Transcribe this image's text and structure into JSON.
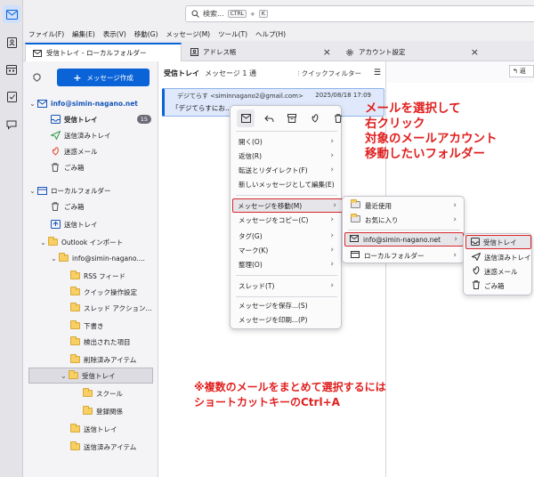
{
  "titlebar": {
    "search_placeholder": "検索...",
    "shortcut_key1": "CTRL",
    "shortcut_plus": "+",
    "shortcut_key2": "K"
  },
  "menubar": [
    "ファイル(F)",
    "編集(E)",
    "表示(V)",
    "移動(G)",
    "メッセージ(M)",
    "ツール(T)",
    "ヘルプ(H)"
  ],
  "tabs": [
    {
      "label": "受信トレイ - ローカルフォルダー",
      "icon": "mail-icon"
    },
    {
      "label": "アドレス帳",
      "icon": "address-book-icon"
    },
    {
      "label": "アカウント設定",
      "icon": "gear-icon"
    }
  ],
  "folder_pane": {
    "compose_label": "メッセージ作成",
    "accounts": [
      {
        "name": "info@simin-nagano.net",
        "folders": [
          {
            "label": "受信トレイ",
            "badge": "15",
            "icon": "inbox-icon"
          },
          {
            "label": "送信済みトレイ",
            "icon": "send-icon"
          },
          {
            "label": "迷惑メール",
            "icon": "junk-icon"
          },
          {
            "label": "ごみ箱",
            "icon": "trash-icon"
          }
        ]
      },
      {
        "name": "ローカルフォルダー",
        "folders": [
          {
            "label": "ごみ箱",
            "icon": "trash-icon"
          },
          {
            "label": "送信トレイ",
            "icon": "outbox-icon"
          },
          {
            "label": "Outlook インポート",
            "icon": "folder-icon"
          },
          {
            "label": "info@simin-nagano....",
            "icon": "folder-icon"
          },
          {
            "label": "RSS フィード",
            "icon": "folder-icon"
          },
          {
            "label": "クイック操作設定",
            "icon": "folder-icon"
          },
          {
            "label": "スレッド アクション...",
            "icon": "folder-icon"
          },
          {
            "label": "下書き",
            "icon": "folder-icon"
          },
          {
            "label": "検出された項目",
            "icon": "folder-icon"
          },
          {
            "label": "削除済みアイテム",
            "icon": "folder-icon"
          },
          {
            "label": "受信トレイ",
            "icon": "folder-icon"
          },
          {
            "label": "スクール",
            "icon": "folder-icon"
          },
          {
            "label": "登録関係",
            "icon": "folder-icon"
          },
          {
            "label": "送信トレイ",
            "icon": "folder-icon"
          },
          {
            "label": "送信済みアイテム",
            "icon": "folder-icon"
          }
        ]
      }
    ]
  },
  "message_list": {
    "title": "受信トレイ",
    "count": "メッセージ 1 通",
    "quick_filter": "クイックフィルター",
    "message": {
      "from": "デジてらす <siminnagano2@gmail.com>",
      "date": "2025/08/18 17:09",
      "subject": "「デジてらすにお..."
    }
  },
  "preview": {
    "reply_label": "返"
  },
  "context_menu": {
    "items": [
      {
        "label": "開く(O)",
        "submenu": true
      },
      {
        "label": "返信(R)",
        "submenu": true
      },
      {
        "label": "転送とリダイレクト(F)",
        "submenu": true
      },
      {
        "label": "新しいメッセージとして編集(E)",
        "submenu": false
      },
      {
        "label": "メッセージを移動(M)",
        "submenu": true
      },
      {
        "label": "メッセージをコピー(C)",
        "submenu": true
      },
      {
        "label": "タグ(G)",
        "submenu": true
      },
      {
        "label": "マーク(K)",
        "submenu": true
      },
      {
        "label": "整理(O)",
        "submenu": true
      },
      {
        "label": "スレッド(T)",
        "submenu": true
      },
      {
        "label": "メッセージを保存...(S)",
        "submenu": false
      },
      {
        "label": "メッセージを印刷...(P)",
        "submenu": false
      }
    ]
  },
  "move_submenu": {
    "items": [
      {
        "label": "最近使用",
        "submenu": true
      },
      {
        "label": "お気に入り",
        "submenu": true
      },
      {
        "label": "info@simin-nagano.net",
        "submenu": true
      },
      {
        "label": "ローカルフォルダー",
        "submenu": true
      }
    ]
  },
  "account_submenu": {
    "items": [
      {
        "label": "受信トレイ",
        "icon": "inbox-icon"
      },
      {
        "label": "送信済みトレイ",
        "icon": "send-icon"
      },
      {
        "label": "迷惑メール",
        "icon": "junk-icon"
      },
      {
        "label": "ごみ箱",
        "icon": "trash-icon"
      }
    ]
  },
  "annotations": {
    "lines": [
      "メールを選択して",
      "右クリック",
      "対象のメールアカウント",
      "移動したいフォルダー"
    ],
    "note_line1": "※複数のメールをまとめて選択するには",
    "note_line2": "ショートカットキーのCtrl+A"
  },
  "colors": {
    "accent": "#0a64d8",
    "annotation": "#e0201f",
    "highlight_border": "#d9262a"
  }
}
